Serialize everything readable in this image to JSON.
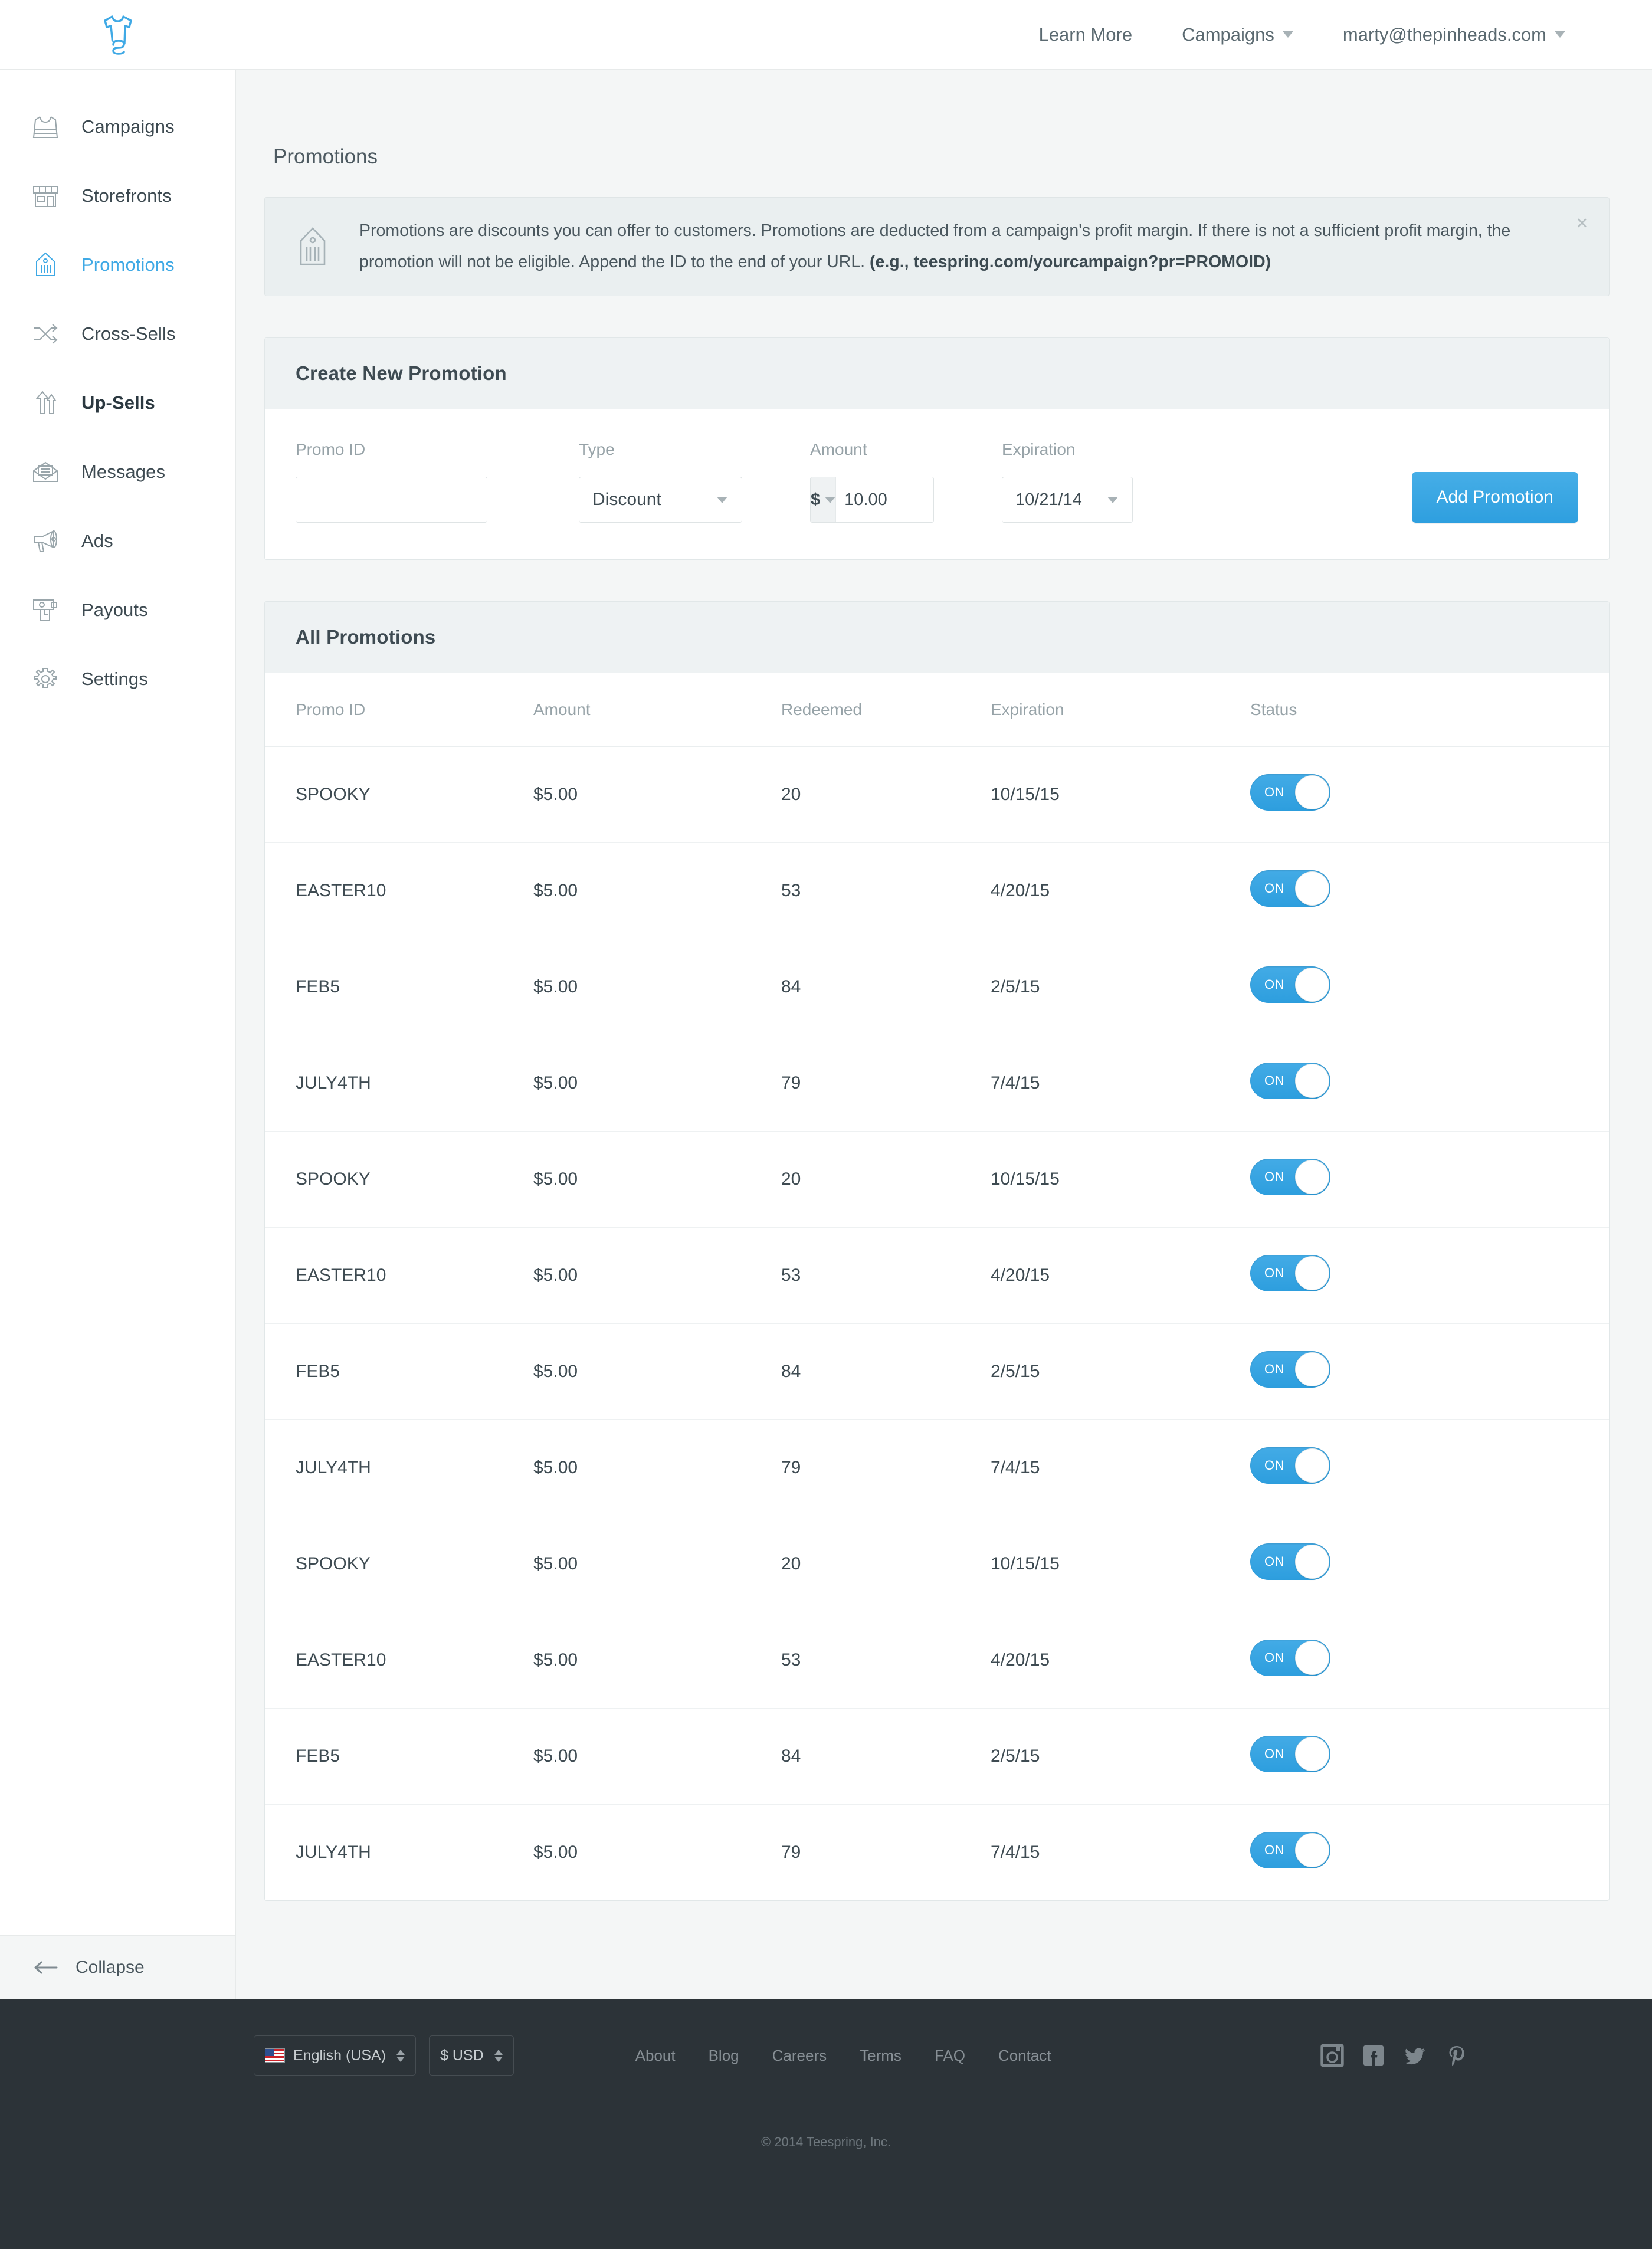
{
  "brand": {
    "logo_icon": "teespring-tshirt-logo",
    "accent_color": "#3fa9e5"
  },
  "topnav": {
    "learn_more": "Learn More",
    "campaigns": "Campaigns",
    "account": "marty@thepinheads.com"
  },
  "sidebar": {
    "items": [
      {
        "label": "Campaigns",
        "icon": "tank-top-icon",
        "state": "normal"
      },
      {
        "label": "Storefronts",
        "icon": "storefront-icon",
        "state": "normal"
      },
      {
        "label": "Promotions",
        "icon": "price-tag-icon",
        "state": "active"
      },
      {
        "label": "Cross-Sells",
        "icon": "shuffle-icon",
        "state": "normal"
      },
      {
        "label": "Up-Sells",
        "icon": "up-arrows-icon",
        "state": "bold"
      },
      {
        "label": "Messages",
        "icon": "envelope-icon",
        "state": "normal"
      },
      {
        "label": "Ads",
        "icon": "megaphone-icon",
        "state": "normal"
      },
      {
        "label": "Payouts",
        "icon": "payout-icon",
        "state": "normal"
      },
      {
        "label": "Settings",
        "icon": "gear-icon",
        "state": "normal"
      }
    ],
    "collapse_label": "Collapse",
    "collapse_icon": "arrow-left-icon"
  },
  "page": {
    "title": "Promotions"
  },
  "banner": {
    "icon": "price-tag-icon",
    "text_plain": "Promotions are discounts you can offer to customers. Promotions are deducted from a campaign's profit margin. If there is not a sufficient profit margin, the promotion will not be eligible. Append the ID to the end of your URL. ",
    "text_bold": "(e.g., teespring.com/yourcampaign?pr=PROMOID)",
    "close_icon": "close-icon"
  },
  "create_form": {
    "title": "Create New Promotion",
    "promo_id_label": "Promo ID",
    "promo_id_value": "",
    "promo_id_placeholder": "",
    "refresh_icon": "refresh-icon",
    "type_label": "Type",
    "type_value": "Discount",
    "amount_label": "Amount",
    "amount_currency": "$",
    "amount_value": "10.00",
    "expiration_label": "Expiration",
    "expiration_value": "10/21/14",
    "submit_label": "Add Promotion"
  },
  "table": {
    "title": "All Promotions",
    "columns": [
      "Promo ID",
      "Amount",
      "Redeemed",
      "Expiration",
      "Status"
    ],
    "toggle_on_label": "ON",
    "rows": [
      {
        "promo_id": "SPOOKY",
        "amount": "$5.00",
        "redeemed": "20",
        "expiration": "10/15/15",
        "status": "ON"
      },
      {
        "promo_id": "EASTER10",
        "amount": "$5.00",
        "redeemed": "53",
        "expiration": "4/20/15",
        "status": "ON"
      },
      {
        "promo_id": "FEB5",
        "amount": "$5.00",
        "redeemed": "84",
        "expiration": "2/5/15",
        "status": "ON"
      },
      {
        "promo_id": "JULY4TH",
        "amount": "$5.00",
        "redeemed": "79",
        "expiration": "7/4/15",
        "status": "ON"
      },
      {
        "promo_id": "SPOOKY",
        "amount": "$5.00",
        "redeemed": "20",
        "expiration": "10/15/15",
        "status": "ON"
      },
      {
        "promo_id": "EASTER10",
        "amount": "$5.00",
        "redeemed": "53",
        "expiration": "4/20/15",
        "status": "ON"
      },
      {
        "promo_id": "FEB5",
        "amount": "$5.00",
        "redeemed": "84",
        "expiration": "2/5/15",
        "status": "ON"
      },
      {
        "promo_id": "JULY4TH",
        "amount": "$5.00",
        "redeemed": "79",
        "expiration": "7/4/15",
        "status": "ON"
      },
      {
        "promo_id": "SPOOKY",
        "amount": "$5.00",
        "redeemed": "20",
        "expiration": "10/15/15",
        "status": "ON"
      },
      {
        "promo_id": "EASTER10",
        "amount": "$5.00",
        "redeemed": "53",
        "expiration": "4/20/15",
        "status": "ON"
      },
      {
        "promo_id": "FEB5",
        "amount": "$5.00",
        "redeemed": "84",
        "expiration": "2/5/15",
        "status": "ON"
      },
      {
        "promo_id": "JULY4TH",
        "amount": "$5.00",
        "redeemed": "79",
        "expiration": "7/4/15",
        "status": "ON"
      }
    ]
  },
  "footer": {
    "language": "English (USA)",
    "currency": "$ USD",
    "links": [
      "About",
      "Blog",
      "Careers",
      "Terms",
      "FAQ",
      "Contact"
    ],
    "social": [
      "instagram-icon",
      "facebook-icon",
      "twitter-icon",
      "pinterest-icon"
    ],
    "copyright": "© 2014 Teespring, Inc."
  }
}
